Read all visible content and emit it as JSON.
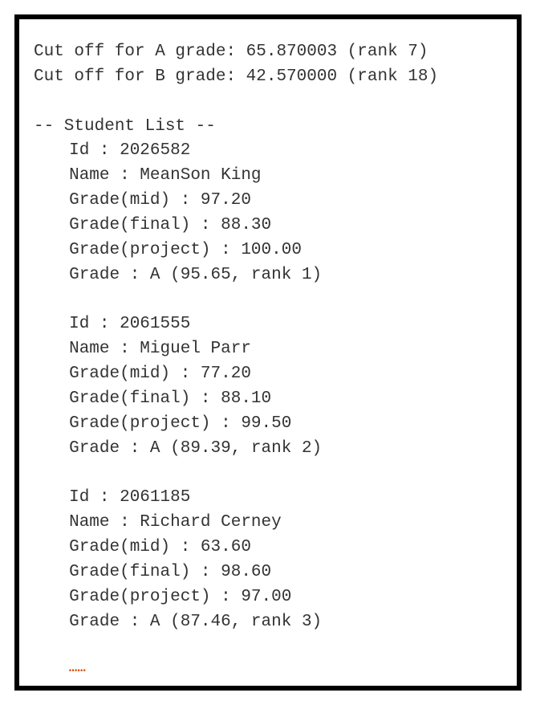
{
  "cutoffs": {
    "a_line": "Cut off for A grade: 65.870003 (rank 7)",
    "b_line": "Cut off for B grade: 42.570000 (rank 18)"
  },
  "student_list_header": "-- Student List --",
  "students": [
    {
      "id": "2026582",
      "name": "MeanSon King",
      "mid": "97.20",
      "final": "88.30",
      "project": "100.00",
      "grade_letter": "A",
      "grade_avg": "95.65",
      "grade_rank": "1"
    },
    {
      "id": "2061555",
      "name": "Miguel Parr",
      "mid": "77.20",
      "final": "88.10",
      "project": "99.50",
      "grade_letter": "A",
      "grade_avg": "89.39",
      "grade_rank": "2"
    },
    {
      "id": "2061185",
      "name": "Richard Cerney",
      "mid": "63.60",
      "final": "98.60",
      "project": "97.00",
      "grade_letter": "A",
      "grade_avg": "87.46",
      "grade_rank": "3"
    }
  ],
  "labels": {
    "id": "Id : ",
    "name": "Name : ",
    "mid": "Grade(mid) : ",
    "final": "Grade(final) : ",
    "project": "Grade(project) : ",
    "grade": "Grade : ",
    "rank_prefix": ", rank "
  },
  "ellipsis": "……"
}
